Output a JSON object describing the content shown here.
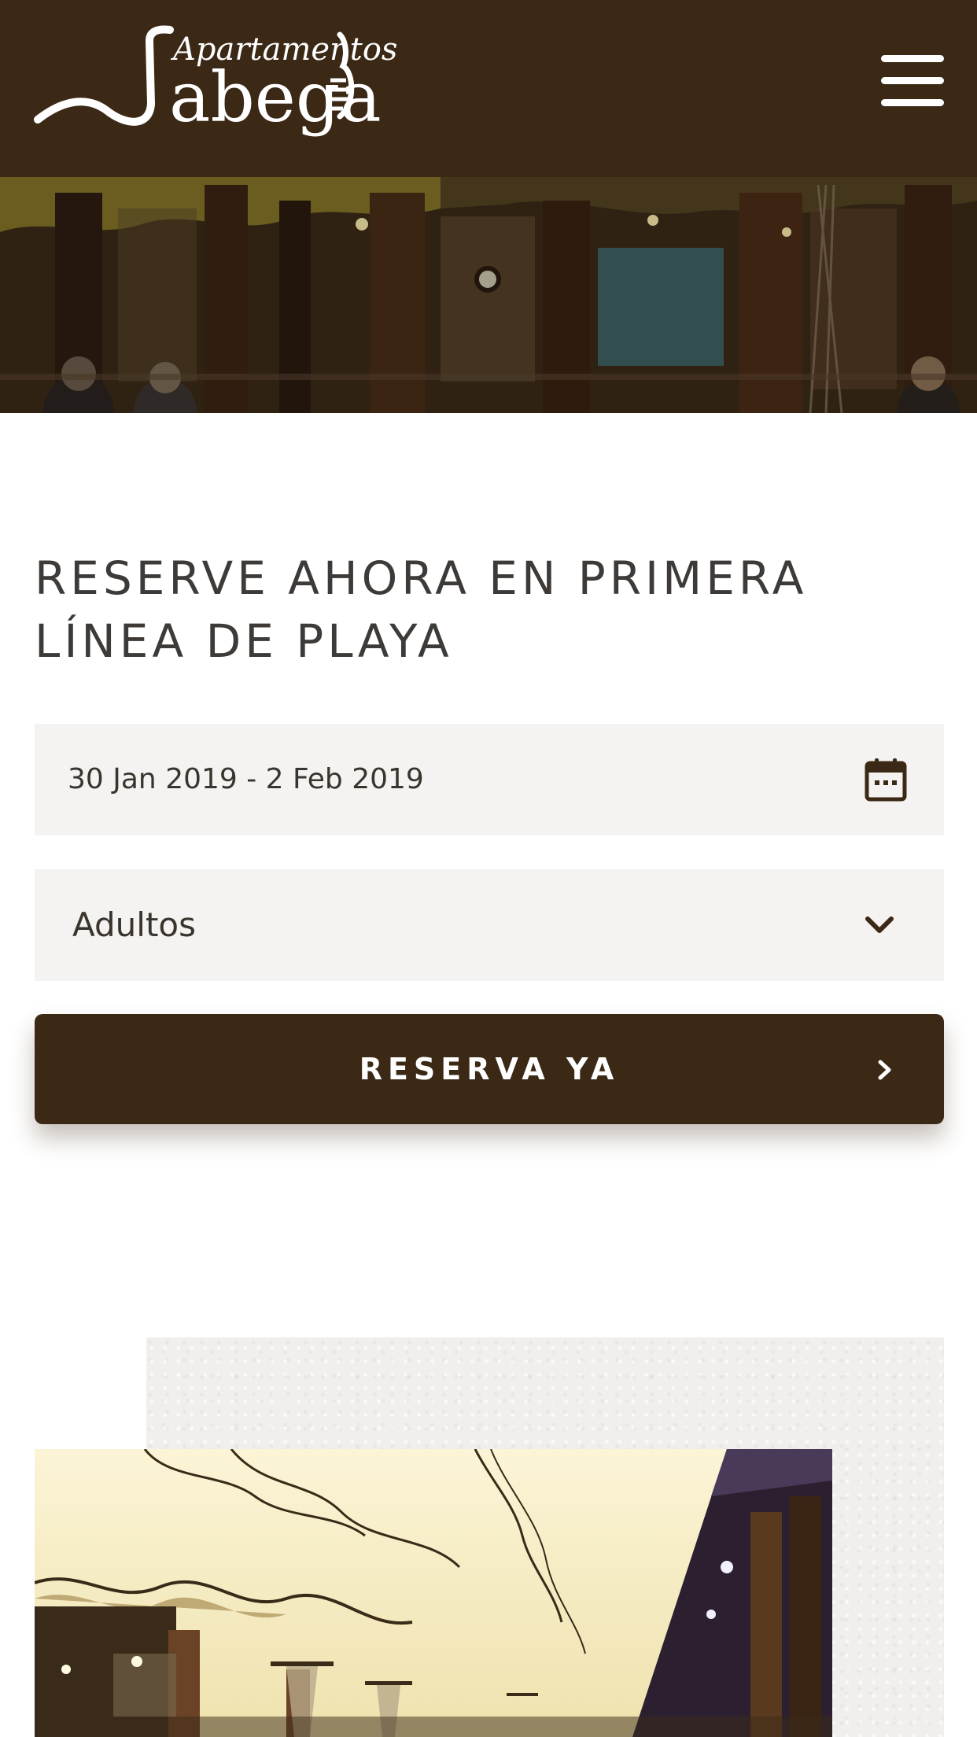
{
  "header": {
    "logo": {
      "top_text": "Apartamentos",
      "main_text": "abega",
      "alt": "Apartamentos Jabega logo"
    },
    "menu_icon": "hamburger-menu-icon"
  },
  "hero": {
    "image_description": "Restaurant terrace with glass front at night"
  },
  "booking": {
    "heading": "RESERVE AHORA EN PRIMERA LÍNEA DE PLAYA",
    "date_range": "30 Jan 2019 - 2 Feb 2019",
    "date_icon": "calendar-icon",
    "adults_selected": "Adultos",
    "adults_icon": "chevron-down-icon",
    "submit_label": "RESERVA YA",
    "submit_icon": "chevron-right-icon"
  },
  "gallery": {
    "image_description": "Restaurant interior with wavy fabric ceiling and patio heaters"
  },
  "colors": {
    "brand_brown": "#3b2916",
    "field_bg": "#f4f3f1",
    "heading_text": "#3d3a37",
    "white": "#ffffff"
  }
}
